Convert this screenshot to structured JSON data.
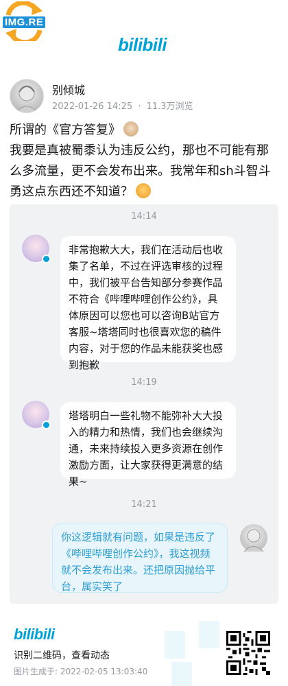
{
  "watermark": {
    "text": "IMG.RE"
  },
  "brand": {
    "logo_text": "bilibili"
  },
  "post": {
    "author": "别倾城",
    "date": "2022-01-26 14:25",
    "separator": "·",
    "views": "11.3万浏览",
    "line1": "所谓的《官方答复》",
    "line2": "我要是真被蜀黍认为违反公约，那也不可能有那么多流量，更不会发布出来。我常年和sh斗智斗勇这点东西还不知道？"
  },
  "chat": {
    "messages": [
      {
        "time": "14:14",
        "sender": "other",
        "text": "非常抱歉大大，我们在活动后也收集了名单，不过在评选审核的过程中，我们被平台告知部分参赛作品不符合《哔哩哔哩创作公约》，具体原因可以您也可以咨询B站官方客服~塔塔同时也很喜欢您的稿件内容，对于您的作品未能获奖也感到抱歉"
      },
      {
        "time": "14:19",
        "sender": "other",
        "text": "塔塔明白一些礼物不能弥补大大投入的精力和热情，我们也会继续沟通，未来持续投入更多资源在创作激励方面，让大家获得更满意的结果~"
      },
      {
        "time": "14:21",
        "sender": "self",
        "text": "你这逻辑就有问题，如果是违反了《哔哩哔哩创作公约》，我这视频就不会发布出来。还把原因抛给平台，属实笑了"
      }
    ]
  },
  "footer": {
    "logo_text": "bilibili",
    "scan_text": "识别二维码，查看动态",
    "generated": "图片生成于: 2022-02-05 13:03:40"
  }
}
